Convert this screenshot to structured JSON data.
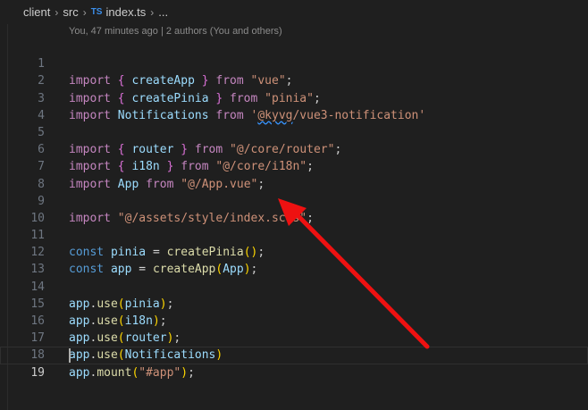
{
  "breadcrumb": {
    "items": [
      "client",
      "src"
    ],
    "file_icon": "TS",
    "file_name": "index.ts",
    "ellipsis": "..."
  },
  "blame": {
    "text": "You, 47 minutes ago | 2 authors (You and others)"
  },
  "editor": {
    "lines": [
      {
        "n": "1"
      },
      {
        "n": "2"
      },
      {
        "n": "3"
      },
      {
        "n": "4"
      },
      {
        "n": "5"
      },
      {
        "n": "6"
      },
      {
        "n": "7"
      },
      {
        "n": "8"
      },
      {
        "n": "9"
      },
      {
        "n": "10"
      },
      {
        "n": "11"
      },
      {
        "n": "12"
      },
      {
        "n": "13"
      },
      {
        "n": "14"
      },
      {
        "n": "15"
      },
      {
        "n": "16"
      },
      {
        "n": "17"
      },
      {
        "n": "18"
      },
      {
        "n": "19"
      }
    ],
    "current_line": "19"
  },
  "tokens": {
    "import": "import",
    "from": "from",
    "const": "const",
    "lbrace": "{",
    "rbrace": "}",
    "createApp": "createApp",
    "createPinia": "createPinia",
    "Notifications": "Notifications",
    "router": "router",
    "i18n": "i18n",
    "App": "App",
    "pinia": "pinia",
    "app": "app",
    "use": "use",
    "mount": "mount",
    "str_vue": "\"vue\"",
    "str_pinia": "\"pinia\"",
    "str_notif_q": "'",
    "str_notif_kyvg": "@kyvg",
    "str_notif_rest": "/vue3-notification'",
    "str_router": "\"@/core/router\"",
    "str_i18n": "\"@/core/i18n\"",
    "str_appvue": "\"@/App.vue\"",
    "str_scss": "\"@/assets/style/index.scss\"",
    "str_hash_app": "\"#app\""
  },
  "colors": {
    "background": "#1f1f1f",
    "arrow": "#ee1111"
  },
  "icons": {
    "file_type": "typescript-file-icon",
    "separator": "chevron-right-icon"
  }
}
